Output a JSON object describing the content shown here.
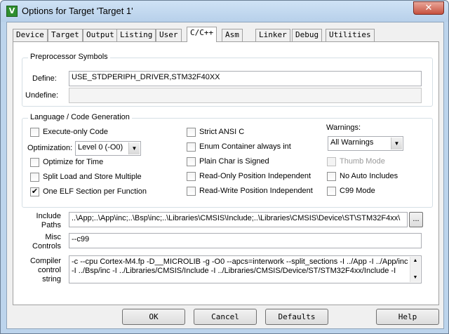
{
  "window": {
    "title": "Options for Target 'Target 1'",
    "icon": "keil-uvision-icon",
    "close_glyph": "✕",
    "icon_glyph": "V"
  },
  "tabs": [
    "Device",
    "Target",
    "Output",
    "Listing",
    "User",
    "C/C++",
    "Asm",
    "Linker",
    "Debug",
    "Utilities"
  ],
  "active_tab": "C/C++",
  "preprocessor": {
    "title": "Preprocessor Symbols",
    "define_label": "Define:",
    "define_value": "USE_STDPERIPH_DRIVER,STM32F40XX",
    "undefine_label": "Undefine:",
    "undefine_value": ""
  },
  "language": {
    "title": "Language / Code Generation",
    "execute_only": {
      "label": "Execute-only Code",
      "checked": false
    },
    "optimization_label": "Optimization:",
    "optimization_value": "Level 0 (-O0)",
    "optimize_time": {
      "label": "Optimize for Time",
      "checked": false
    },
    "split_load": {
      "label": "Split Load and Store Multiple",
      "checked": false
    },
    "one_elf": {
      "label": "One ELF Section per Function",
      "checked": true
    },
    "strict_ansi": {
      "label": "Strict ANSI C",
      "checked": false
    },
    "enum_container": {
      "label": "Enum Container always int",
      "checked": false
    },
    "plain_char": {
      "label": "Plain Char is Signed",
      "checked": false
    },
    "ro_pos": {
      "label": "Read-Only Position Independent",
      "checked": false
    },
    "rw_pos": {
      "label": "Read-Write Position Independent",
      "checked": false
    },
    "warnings_label": "Warnings:",
    "warnings_value": "All Warnings",
    "thumb_mode": {
      "label": "Thumb Mode",
      "checked": false,
      "disabled": true
    },
    "no_auto_includes": {
      "label": "No Auto Includes",
      "checked": false
    },
    "c99_mode": {
      "label": "C99 Mode",
      "checked": false
    }
  },
  "include_paths": {
    "label_line1": "Include",
    "label_line2": "Paths",
    "value": "..\\App;..\\App\\inc;..\\Bsp\\inc;..\\Libraries\\CMSIS\\Include;..\\Libraries\\CMSIS\\Device\\ST\\STM32F4xx\\",
    "browse_label": "..."
  },
  "misc_controls": {
    "label_line1": "Misc",
    "label_line2": "Controls",
    "value": "--c99"
  },
  "compiler_control": {
    "label_line1": "Compiler",
    "label_line2": "control",
    "label_line3": "string",
    "value": "-c --cpu Cortex-M4.fp -D__MICROLIB -g -O0 --apcs=interwork --split_sections -I ../App -I ../App/inc -I ../Bsp/inc -I ../Libraries/CMSIS/Include -I ../Libraries/CMSIS/Device/ST/STM32F4xx/Include -I"
  },
  "buttons": {
    "ok": "OK",
    "cancel": "Cancel",
    "defaults": "Defaults",
    "help": "Help"
  },
  "check_glyph": "✔",
  "dropdown_glyph": "▼"
}
